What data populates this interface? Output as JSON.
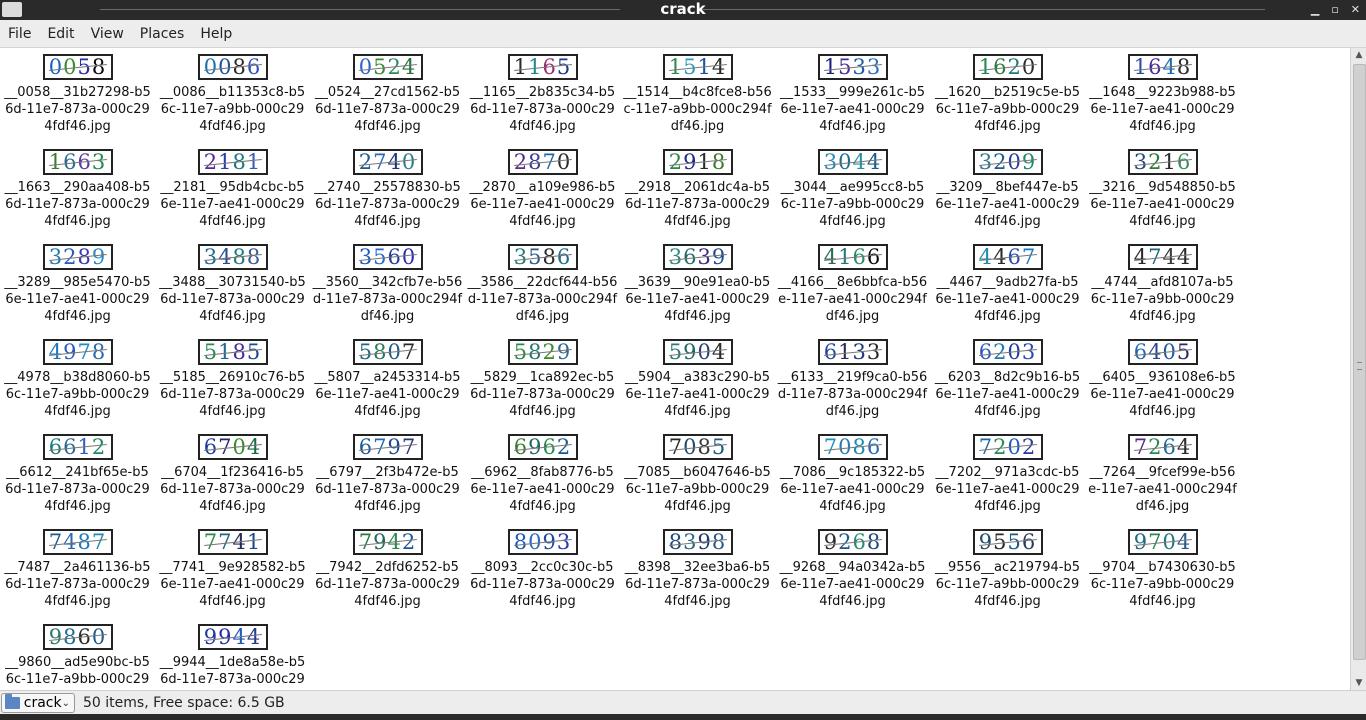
{
  "window": {
    "title": "crack"
  },
  "menubar": {
    "items": [
      "File",
      "Edit",
      "View",
      "Places",
      "Help"
    ]
  },
  "files": [
    {
      "captcha": "0058",
      "colors": [
        "#1a5fbf",
        "#3a8c2a",
        "#2a2aa8",
        "#0a0a0a"
      ],
      "name": "__0058__31b27298-b56d-11e7-873a-000c294fdf46.jpg"
    },
    {
      "captcha": "0086",
      "colors": [
        "#1a6fae",
        "#1e4fa0",
        "#2b2b2b",
        "#3050c0"
      ],
      "name": "__0086__b11353c8-b56c-11e7-a9bb-000c294fdf46.jpg"
    },
    {
      "captcha": "0524",
      "colors": [
        "#2b66c8",
        "#3c8a30",
        "#2a8a60",
        "#2a7040"
      ],
      "name": "__0524__27cd1562-b56d-11e7-873a-000c294fdf46.jpg"
    },
    {
      "captcha": "1165",
      "colors": [
        "#2a2a2a",
        "#1e8a90",
        "#9a2a6a",
        "#1e3a8a"
      ],
      "name": "__1165__2b835c34-b56d-11e7-873a-000c294fdf46.jpg"
    },
    {
      "captcha": "1514",
      "colors": [
        "#2a8a50",
        "#2aa0c0",
        "#1e4fa0",
        "#2a2a2a"
      ],
      "name": "__1514__b4c8fce8-b56c-11e7-a9bb-000c294fdf46.jpg"
    },
    {
      "captcha": "1533",
      "colors": [
        "#1a1a80",
        "#4a2a9a",
        "#1e5aa8",
        "#2a70c0"
      ],
      "name": "__1533__999e261c-b56e-11e7-ae41-000c294fdf46.jpg"
    },
    {
      "captcha": "1620",
      "colors": [
        "#1e8a50",
        "#2a7a3a",
        "#1e7a7a",
        "#2a2a2a"
      ],
      "name": "__1620__b2519c5e-b56c-11e7-a9bb-000c294fdf46.jpg"
    },
    {
      "captcha": "1648",
      "colors": [
        "#2a4aa8",
        "#4a2a9a",
        "#1e6ab0",
        "#2a2a2a"
      ],
      "name": "__1648__9223b988-b56e-11e7-ae41-000c294fdf46.jpg"
    },
    {
      "captcha": "1663",
      "colors": [
        "#3a7a2a",
        "#2a6a90",
        "#5a3a9a",
        "#1e8a50"
      ],
      "name": "__1663__290aa408-b56d-11e7-873a-000c294fdf46.jpg"
    },
    {
      "captcha": "2181",
      "colors": [
        "#5a2a9a",
        "#2a3ab0",
        "#1e7a7a",
        "#3a5ac0"
      ],
      "name": "__2181__95db4cbc-b56e-11e7-ae41-000c294fdf46.jpg"
    },
    {
      "captcha": "2740",
      "colors": [
        "#1e5a8a",
        "#2a6ab0",
        "#1e3a7a",
        "#2a7a90"
      ],
      "name": "__2740__25578830-b56d-11e7-873a-000c294fdf46.jpg"
    },
    {
      "captcha": "2870",
      "colors": [
        "#5a2a8a",
        "#3a3a9a",
        "#1e6aa0",
        "#2a2a2a"
      ],
      "name": "__2870__a109e986-b56e-11e7-ae41-000c294fdf46.jpg"
    },
    {
      "captcha": "2918",
      "colors": [
        "#2a8a40",
        "#1e2a8a",
        "#2a2a2a",
        "#3a7a2a"
      ],
      "name": "__2918__2061dc4a-b56d-11e7-873a-000c294fdf46.jpg"
    },
    {
      "captcha": "3044",
      "colors": [
        "#2a8ab0",
        "#1e6a90",
        "#2a90a0",
        "#1e5a8a"
      ],
      "name": "__3044__ae995cc8-b56c-11e7-a9bb-000c294fdf46.jpg"
    },
    {
      "captcha": "3209",
      "colors": [
        "#2a7a90",
        "#1e5a8a",
        "#2a3a9a",
        "#1e8a60"
      ],
      "name": "__3209__8bef447e-b56e-11e7-ae41-000c294fdf46.jpg"
    },
    {
      "captcha": "3216",
      "colors": [
        "#1e4a7a",
        "#2a7a3a",
        "#2a2a2a",
        "#3a8a5a"
      ],
      "name": "__3216__9d548850-b56e-11e7-ae41-000c294fdf46.jpg"
    },
    {
      "captcha": "3289",
      "colors": [
        "#1e7ab0",
        "#2a5ac0",
        "#3a3aa8",
        "#2a8ac0"
      ],
      "name": "__3289__985e5470-b56e-11e7-ae41-000c294fdf46.jpg"
    },
    {
      "captcha": "3488",
      "colors": [
        "#1e6a90",
        "#2a4a8a",
        "#1e7a7a",
        "#3a5a9a"
      ],
      "name": "__3488__30731540-b56d-11e7-873a-000c294fdf46.jpg"
    },
    {
      "captcha": "3560",
      "colors": [
        "#1e5ac0",
        "#2a6ad0",
        "#1e3a9a",
        "#2a2ab0"
      ],
      "name": "__3560__342cfb7e-b56d-11e7-873a-000c294fdf46.jpg"
    },
    {
      "captcha": "3586",
      "colors": [
        "#1e7a7a",
        "#2a5a8a",
        "#2a2a2a",
        "#1e6a90"
      ],
      "name": "__3586__22dcf644-b56d-11e7-873a-000c294fdf46.jpg"
    },
    {
      "captcha": "3639",
      "colors": [
        "#2a8a80",
        "#1e6a6a",
        "#3a2a8a",
        "#1e4a8a"
      ],
      "name": "__3639__90e91ea0-b56e-11e7-ae41-000c294fdf46.jpg"
    },
    {
      "captcha": "4166",
      "colors": [
        "#2a6a50",
        "#1e7a7a",
        "#2a8a60",
        "#0a0a0a"
      ],
      "name": "__4166__8e6bbfca-b56e-11e7-ae41-000c294fdf46.jpg"
    },
    {
      "captcha": "4467",
      "colors": [
        "#1e8ab0",
        "#2a2a2a",
        "#2a4ab0",
        "#1e7ac0"
      ],
      "name": "__4467__9adb27fa-b56e-11e7-ae41-000c294fdf46.jpg"
    },
    {
      "captcha": "4744",
      "colors": [
        "#2a2a2a",
        "#1e6a80",
        "#3a3a3a",
        "#2a2a2a"
      ],
      "name": "__4744__afd8107a-b56c-11e7-a9bb-000c294fdf46.jpg"
    },
    {
      "captcha": "4978",
      "colors": [
        "#1e7ac0",
        "#2a5ac0",
        "#1e90c0",
        "#2a6ab0"
      ],
      "name": "__4978__b38d8060-b56c-11e7-a9bb-000c294fdf46.jpg"
    },
    {
      "captcha": "5185",
      "colors": [
        "#2a8a50",
        "#1e6a90",
        "#4a2a9a",
        "#1e4a8a"
      ],
      "name": "__5185__26910c76-b56d-11e7-873a-000c294fdf46.jpg"
    },
    {
      "captcha": "5807",
      "colors": [
        "#1e6a80",
        "#2a7a5a",
        "#1e5a8a",
        "#2a2a2a"
      ],
      "name": "__5807__a2453314-b56e-11e7-ae41-000c294fdf46.jpg"
    },
    {
      "captcha": "5829",
      "colors": [
        "#2a8a40",
        "#1e7a6a",
        "#3a8a2a",
        "#2a6a90"
      ],
      "name": "__5829__1ca892ec-b56d-11e7-873a-000c294fdf46.jpg"
    },
    {
      "captcha": "5904",
      "colors": [
        "#2a7a7a",
        "#1e6a60",
        "#2a3a7a",
        "#2a2a2a"
      ],
      "name": "__5904__a383c290-b56e-11e7-ae41-000c294fdf46.jpg"
    },
    {
      "captcha": "6133",
      "colors": [
        "#1e4a9a",
        "#2a2a5a",
        "#1e3a7a",
        "#2a2a2a"
      ],
      "name": "__6133__219f9ca0-b56d-11e7-873a-000c294fdf46.jpg"
    },
    {
      "captcha": "6203",
      "colors": [
        "#2a5ac0",
        "#1e7ab0",
        "#1e3a9a",
        "#2a4ab0"
      ],
      "name": "__6203__8d2c9b16-b56e-11e7-ae41-000c294fdf46.jpg"
    },
    {
      "captcha": "6405",
      "colors": [
        "#1e6ab0",
        "#2a4a8a",
        "#1e5a9a",
        "#2a2a5a"
      ],
      "name": "__6405__936108e6-b56e-11e7-ae41-000c294fdf46.jpg"
    },
    {
      "captcha": "6612",
      "colors": [
        "#1e7a7a",
        "#2a6a90",
        "#3a5ac0",
        "#1e8a60"
      ],
      "name": "__6612__241bf65e-b56d-11e7-873a-000c294fdf46.jpg"
    },
    {
      "captcha": "6704",
      "colors": [
        "#1e3a9a",
        "#2a2a6a",
        "#3a8a2a",
        "#1e6a40"
      ],
      "name": "__6704__1f236416-b56d-11e7-873a-000c294fdf46.jpg"
    },
    {
      "captcha": "6797",
      "colors": [
        "#1e5a9a",
        "#2a6ab0",
        "#1e4a8a",
        "#2a3a7a"
      ],
      "name": "__6797__2f3b472e-b56d-11e7-873a-000c294fdf46.jpg"
    },
    {
      "captcha": "6962",
      "colors": [
        "#3a7a2a",
        "#1e6a60",
        "#2a8a50",
        "#1e5a8a"
      ],
      "name": "__6962__8fab8776-b56e-11e7-ae41-000c294fdf46.jpg"
    },
    {
      "captcha": "7085",
      "colors": [
        "#2a2a2a",
        "#1e4a6a",
        "#3a3a3a",
        "#1e5a7a"
      ],
      "name": "__7085__b6047646-b56c-11e7-a9bb-000c294fdf46.jpg"
    },
    {
      "captcha": "7086",
      "colors": [
        "#1e90c0",
        "#2a7ab0",
        "#1e8ab0",
        "#2a6ab0"
      ],
      "name": "__7086__9c185322-b56e-11e7-ae41-000c294fdf46.jpg"
    },
    {
      "captcha": "7202",
      "colors": [
        "#1e6ab0",
        "#2a8a50",
        "#1e5ac0",
        "#2a3a9a"
      ],
      "name": "__7202__971a3cdc-b56e-11e7-ae41-000c294fdf46.jpg"
    },
    {
      "captcha": "7264",
      "colors": [
        "#5a2a8a",
        "#2a8a50",
        "#1e6a90",
        "#2a2a2a"
      ],
      "name": "__7264__9fcef99e-b56e-11e7-ae41-000c294fdf46.jpg"
    },
    {
      "captcha": "7487",
      "colors": [
        "#1e5a8a",
        "#2a6ab0",
        "#1e7ac0",
        "#1e8ab0"
      ],
      "name": "__7487__2a461136-b56d-11e7-873a-000c294fdf46.jpg"
    },
    {
      "captcha": "7741",
      "colors": [
        "#2a8a40",
        "#1e6a80",
        "#2a2a5a",
        "#1e4a8a"
      ],
      "name": "__7741__9e928582-b56e-11e7-ae41-000c294fdf46.jpg"
    },
    {
      "captcha": "7942",
      "colors": [
        "#2a7a3a",
        "#1e6a60",
        "#2a8a50",
        "#1e5a9a"
      ],
      "name": "__7942__2dfd6252-b56d-11e7-873a-000c294fdf46.jpg"
    },
    {
      "captcha": "8093",
      "colors": [
        "#1e5ab0",
        "#2a6ac0",
        "#1e4a9a",
        "#2a3ab0"
      ],
      "name": "__8093__2cc0c30c-b56d-11e7-873a-000c294fdf46.jpg"
    },
    {
      "captcha": "8398",
      "colors": [
        "#1e4a7a",
        "#2a6a90",
        "#1e3a6a",
        "#2a5a8a"
      ],
      "name": "__8398__32ee3ba6-b56d-11e7-873a-000c294fdf46.jpg"
    },
    {
      "captcha": "9268",
      "colors": [
        "#2a2a2a",
        "#1e5a8a",
        "#2a8a70",
        "#1e4a7a"
      ],
      "name": "__9268__94a0342a-b56e-11e7-ae41-000c294fdf46.jpg"
    },
    {
      "captcha": "9556",
      "colors": [
        "#1e4a6a",
        "#2a2a2a",
        "#1e5a8a",
        "#2a3a5a"
      ],
      "name": "__9556__ac219794-b56c-11e7-a9bb-000c294fdf46.jpg"
    },
    {
      "captcha": "9704",
      "colors": [
        "#1e6a80",
        "#2a8a50",
        "#1e7a7a",
        "#2a5a8a"
      ],
      "name": "__9704__b7430630-b56c-11e7-a9bb-000c294fdf46.jpg"
    },
    {
      "captcha": "9860",
      "colors": [
        "#2a7a6a",
        "#1e6a90",
        "#2a2a2a",
        "#1e5a8a"
      ],
      "name": "__9860__ad5e90bc-b56c-11e7-a9bb-000c294fdf46.jpg"
    },
    {
      "captcha": "9944",
      "colors": [
        "#1e3a9a",
        "#2a2ab0",
        "#1e5ac0",
        "#2a3a8a"
      ],
      "name": "__9944__1de8a58e-b56d-11e7-873a-000c294fdf46.jpg"
    }
  ],
  "statusbar": {
    "location": "crack",
    "text": "50 items, Free space: 6.5 GB"
  },
  "icons": {
    "folder": "folder-icon",
    "combo_arrow": "chevron-down-icon",
    "scroll_up": "scroll-up-icon",
    "scroll_down": "scroll-down-icon"
  }
}
